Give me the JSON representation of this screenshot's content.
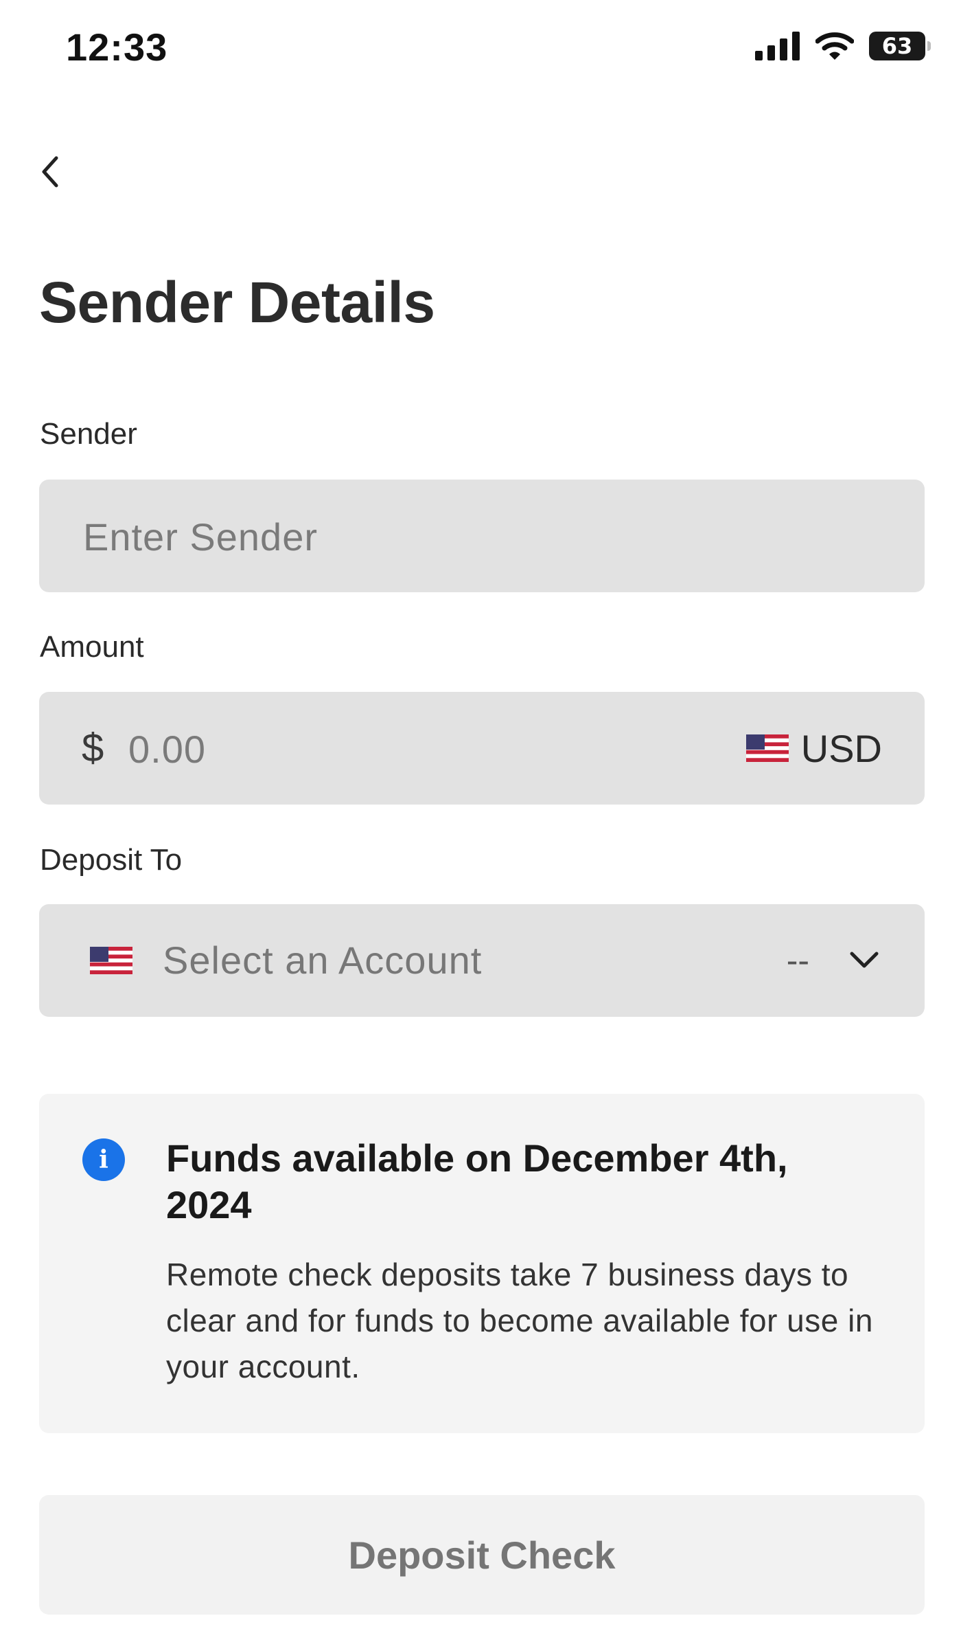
{
  "status_bar": {
    "time": "12:33",
    "battery": "63",
    "icons": [
      "signal-icon",
      "wifi-icon",
      "battery-icon"
    ]
  },
  "nav": {
    "back_icon": "chevron-left-icon"
  },
  "page": {
    "title": "Sender Details"
  },
  "form": {
    "sender": {
      "label": "Sender",
      "value": "",
      "placeholder": "Enter Sender"
    },
    "amount": {
      "label": "Amount",
      "currency_symbol": "$",
      "value": "",
      "placeholder": "0.00",
      "currency": "USD",
      "currency_flag": "us-flag-icon"
    },
    "deposit_to": {
      "label": "Deposit To",
      "placeholder": "Select an Account",
      "balance": "--",
      "flag": "us-flag-icon",
      "chevron": "chevron-down-icon"
    }
  },
  "info": {
    "icon": "info-icon",
    "title": "Funds available on December 4th, 2024",
    "body": "Remote check deposits take 7 business days to clear and for funds to become available for use in your account.",
    "accent_color": "#1a73e8"
  },
  "actions": {
    "deposit_label": "Deposit Check"
  }
}
